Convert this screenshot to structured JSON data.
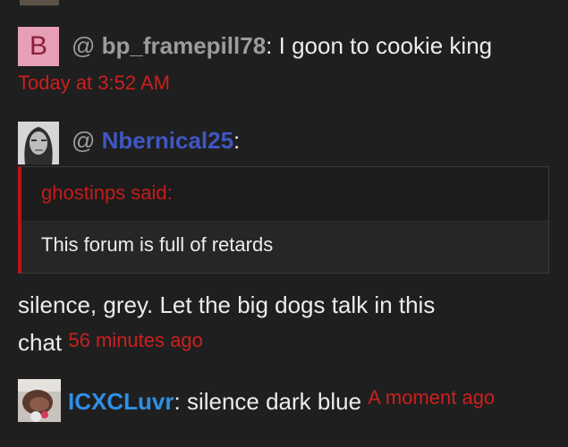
{
  "messages": [
    {
      "avatar_letter": "B",
      "at": "@",
      "username": "bp_framepill78",
      "separator": ":",
      "text": "I goon to cookie king",
      "timestamp": "Today at 3:52 AM",
      "username_color": "#9c9c9c"
    },
    {
      "at": "@",
      "username": "Nbernical25",
      "separator": ":",
      "username_color": "#3f57c4",
      "quote": {
        "author": "ghostinps said:",
        "text": "This forum is full of retards"
      },
      "text_line1": "silence, grey. Let the big dogs talk in this",
      "text_line2": "chat",
      "timestamp": "56 minutes ago"
    },
    {
      "username": "ICXCLuvr",
      "separator": ":",
      "text": "silence dark blue",
      "timestamp": "A moment ago",
      "username_color": "#2f8fe6"
    }
  ],
  "colors": {
    "background": "#1f1f1f",
    "timestamp": "#cc1f1f",
    "quote_bar": "#b8141b"
  }
}
